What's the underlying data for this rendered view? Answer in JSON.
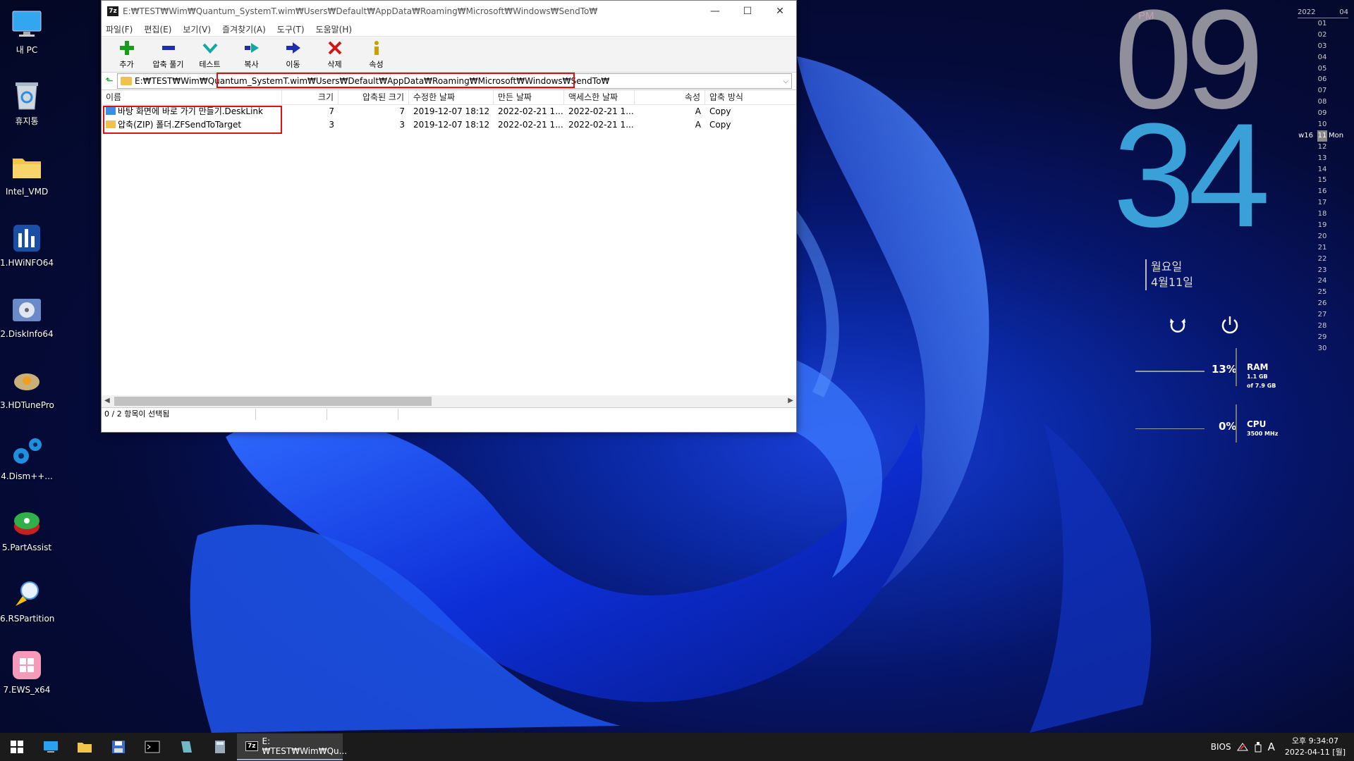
{
  "desktop": {
    "icons": [
      {
        "label": "내 PC",
        "icon": "monitor-icon"
      },
      {
        "label": "휴지통",
        "icon": "recycle-bin-icon"
      },
      {
        "label": "Intel_VMD",
        "icon": "folder-icon"
      },
      {
        "label": "1.HWiNFO64",
        "icon": "hwinfo-icon"
      },
      {
        "label": "2.DiskInfo64",
        "icon": "diskinfo-icon"
      },
      {
        "label": "3.HDTunePro",
        "icon": "hdtune-icon"
      },
      {
        "label": "4.Dism++...",
        "icon": "gears-icon"
      },
      {
        "label": "5.PartAssist",
        "icon": "partassist-icon"
      },
      {
        "label": "6.RSPartition",
        "icon": "rspartition-icon"
      },
      {
        "label": "7.EWS_x64",
        "icon": "ews-icon"
      }
    ]
  },
  "window": {
    "title": "E:₩TEST₩Wim₩Quantum_SystemT.wim₩Users₩Default₩AppData₩Roaming₩Microsoft₩Windows₩SendTo₩",
    "app_icon_text": "7z",
    "menu": [
      "파일(F)",
      "편집(E)",
      "보기(V)",
      "즐겨찾기(A)",
      "도구(T)",
      "도움말(H)"
    ],
    "toolbar": [
      {
        "label": "추가",
        "icon": "add-icon",
        "color": "#1a9c1a"
      },
      {
        "label": "압축 풀기",
        "icon": "extract-icon",
        "color": "#1d2fb0"
      },
      {
        "label": "테스트",
        "icon": "test-icon",
        "color": "#13a7a0"
      },
      {
        "label": "복사",
        "icon": "copy-icon",
        "color": "#13a7a0"
      },
      {
        "label": "이동",
        "icon": "move-icon",
        "color": "#1d2fb0"
      },
      {
        "label": "삭제",
        "icon": "delete-icon",
        "color": "#d01818"
      },
      {
        "label": "속성",
        "icon": "info-icon",
        "color": "#c8a000"
      }
    ],
    "address": {
      "prefix": "E:₩TEST₩Wim₩",
      "highlighted": "Quantum_SystemT.wim₩Users₩Default₩AppData₩Roaming₩Microsoft₩Windows₩SendTo₩"
    },
    "columns": [
      "이름",
      "크기",
      "압축된 크기",
      "수정한 날짜",
      "만든 날짜",
      "액세스한 날짜",
      "속성",
      "압축 방식"
    ],
    "rows": [
      {
        "name": "바탕 화면에 바로 가기 만들기.DeskLink",
        "size": "7",
        "packed": "7",
        "modified": "2019-12-07 18:12",
        "created": "2022-02-21 1...",
        "accessed": "2022-02-21 1...",
        "attr": "A",
        "method": "Copy",
        "icon": "desklink-icon"
      },
      {
        "name": "압축(ZIP) 폴더.ZFSendToTarget",
        "size": "3",
        "packed": "3",
        "modified": "2019-12-07 18:12",
        "created": "2022-02-21 1...",
        "accessed": "2022-02-21 1...",
        "attr": "A",
        "method": "Copy",
        "icon": "zip-folder-icon"
      }
    ],
    "status": "0 / 2 항목이 선택됨"
  },
  "clock": {
    "ampm": "PM",
    "hour": "09",
    "minute": "34",
    "weekday": "월요일",
    "date": "4월11일",
    "accent": "#3aa0d8"
  },
  "meters": {
    "ram": {
      "pct": "13%",
      "name": "RAM",
      "detail1": "1.1 GB",
      "detail2": "of 7.9 GB"
    },
    "cpu": {
      "pct": "0%",
      "name": "CPU",
      "detail": "3500 MHz"
    }
  },
  "calendar": {
    "year": "2022",
    "month": "04",
    "days": [
      "01",
      "02",
      "03",
      "04",
      "05",
      "06",
      "07",
      "08",
      "09",
      "10",
      "11",
      "12",
      "13",
      "14",
      "15",
      "16",
      "17",
      "18",
      "19",
      "20",
      "21",
      "22",
      "23",
      "24",
      "25",
      "26",
      "27",
      "28",
      "29",
      "30"
    ],
    "today": "11",
    "week_label": "w16",
    "today_weekday": "Mon"
  },
  "taskbar": {
    "active_title": "E:₩TEST₩Wim₩Qu...",
    "tray_bios": "BIOS",
    "tray_ime": "A",
    "time": "오후 9:34:07",
    "date": "2022-04-11 [월]"
  }
}
